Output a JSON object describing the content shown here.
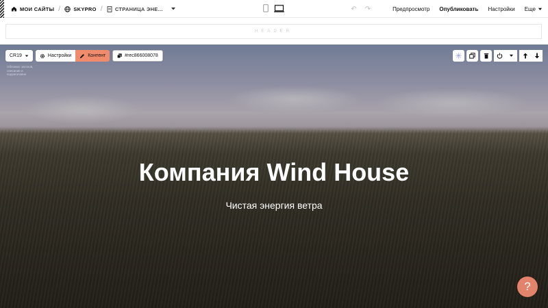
{
  "topbar": {
    "crumbs": [
      {
        "label": "МОИ САЙТЫ",
        "icon": "home-icon"
      },
      {
        "label": "SKYPRO",
        "icon": "globe-icon"
      },
      {
        "label": "СТРАНИЦА ЭНЕ...",
        "icon": "page-icon"
      }
    ],
    "devices": [
      "mobile-icon",
      "desktop-icon"
    ],
    "preview": "Предпросмотр",
    "publish": "Опубликовать",
    "settings": "Настройки",
    "more": "Еще",
    "undo_icon": "undo-icon",
    "redo_icon": "redo-icon"
  },
  "header_block": {
    "label": "HEADER"
  },
  "block": {
    "code": "CR19",
    "settings_label": "Настройки",
    "content_label": "Контент",
    "rec_id": "#rec866008078",
    "hint": "Обложка: заголов, описание и подзаголовок"
  },
  "hero": {
    "title": "Компания Wind House",
    "subtitle": "Чистая энергия ветра"
  },
  "right_controls": [
    "magic-icon",
    "duplicate-icon",
    "delete-icon",
    "power-icon",
    "chevron-down-icon",
    "arrow-up-icon",
    "arrow-down-icon"
  ],
  "help": {
    "label": "?"
  },
  "colors": {
    "accent": "#f08b6b",
    "help": "#e4836b"
  }
}
